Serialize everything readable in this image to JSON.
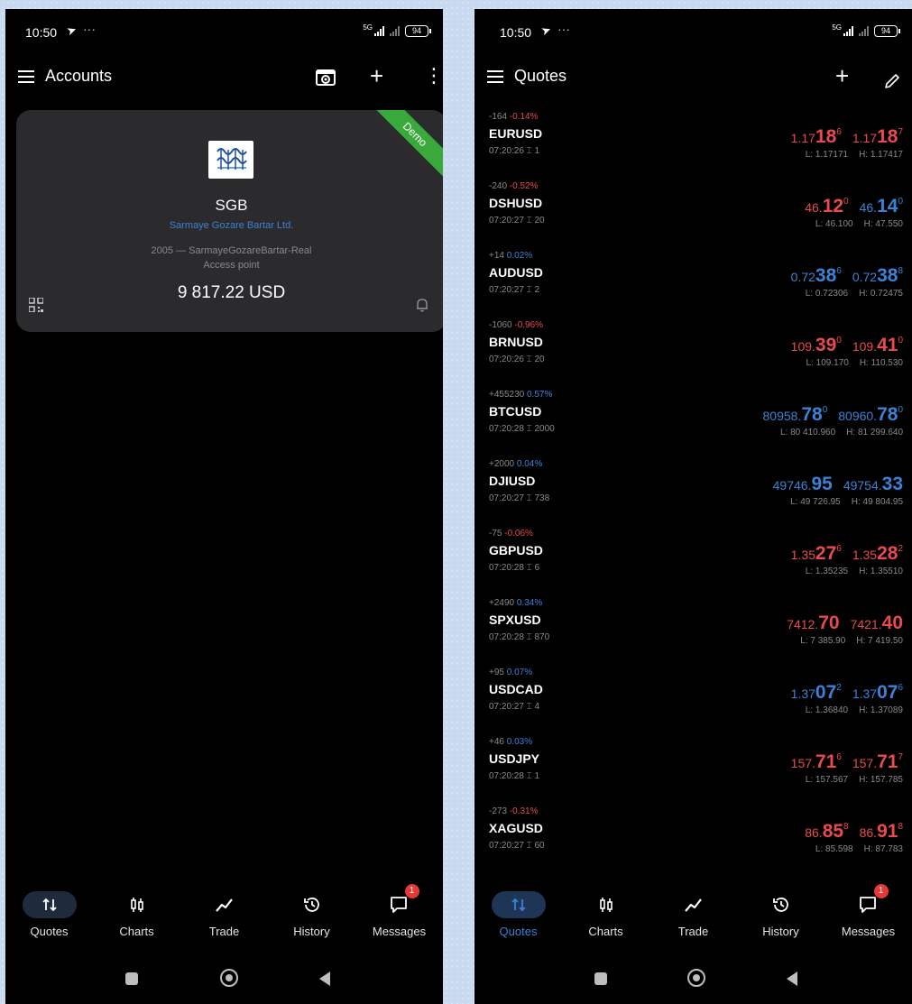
{
  "status_bar": {
    "time": "10:50",
    "dots": "···",
    "battery": "94",
    "net_label": "5G"
  },
  "accounts_screen": {
    "title": "Accounts",
    "card": {
      "ribbon": "Demo",
      "name": "SGB",
      "company": "Sarmaye Gozare Bartar Ltd.",
      "server": "2005 — SarmayeGozareBartar-Real",
      "access": "Access point",
      "balance": "9 817.22 USD"
    }
  },
  "quotes_screen": {
    "title": "Quotes",
    "quotes": [
      {
        "change": "-164",
        "pct": "-0.14%",
        "dir": "neg",
        "symbol": "EURUSD",
        "time": "07:20:26",
        "spread": "1",
        "bid": {
          "pre": "1.17",
          "big": "18",
          "sup": "6"
        },
        "ask": {
          "pre": "1.17",
          "big": "18",
          "sup": "7"
        },
        "low": "L: 1.17171",
        "high": "H: 1.17417",
        "color": "neg"
      },
      {
        "change": "-240",
        "pct": "-0.52%",
        "dir": "neg",
        "symbol": "DSHUSD",
        "time": "07:20:27",
        "spread": "20",
        "bid": {
          "pre": "46.",
          "big": "12",
          "sup": "0"
        },
        "ask": {
          "pre": "46.",
          "big": "14",
          "sup": "0"
        },
        "low": "L: 46.100",
        "high": "H: 47.550",
        "color": "mixed"
      },
      {
        "change": "+14",
        "pct": "0.02%",
        "dir": "pos",
        "symbol": "AUDUSD",
        "time": "07:20:27",
        "spread": "2",
        "bid": {
          "pre": "0.72",
          "big": "38",
          "sup": "6"
        },
        "ask": {
          "pre": "0.72",
          "big": "38",
          "sup": "8"
        },
        "low": "L: 0.72306",
        "high": "H: 0.72475",
        "color": "pos"
      },
      {
        "change": "-1060",
        "pct": "-0.96%",
        "dir": "neg",
        "symbol": "BRNUSD",
        "time": "07:20:26",
        "spread": "20",
        "bid": {
          "pre": "109.",
          "big": "39",
          "sup": "0"
        },
        "ask": {
          "pre": "109.",
          "big": "41",
          "sup": "0"
        },
        "low": "L: 109.170",
        "high": "H: 110.530",
        "color": "neg"
      },
      {
        "change": "+455230",
        "pct": "0.57%",
        "dir": "pos",
        "symbol": "BTCUSD",
        "time": "07:20:28",
        "spread": "2000",
        "bid": {
          "pre": "80958.",
          "big": "78",
          "sup": "0"
        },
        "ask": {
          "pre": "80960.",
          "big": "78",
          "sup": "0"
        },
        "low": "L: 80 410.960",
        "high": "H: 81 299.640",
        "color": "pos"
      },
      {
        "change": "+2000",
        "pct": "0.04%",
        "dir": "pos",
        "symbol": "DJIUSD",
        "time": "07:20:27",
        "spread": "738",
        "bid": {
          "pre": "49746.",
          "big": "95",
          "sup": ""
        },
        "ask": {
          "pre": "49754.",
          "big": "33",
          "sup": ""
        },
        "low": "L: 49 726.95",
        "high": "H: 49 804.95",
        "color": "pos"
      },
      {
        "change": "-75",
        "pct": "-0.06%",
        "dir": "neg",
        "symbol": "GBPUSD",
        "time": "07:20:28",
        "spread": "6",
        "bid": {
          "pre": "1.35",
          "big": "27",
          "sup": "6"
        },
        "ask": {
          "pre": "1.35",
          "big": "28",
          "sup": "2"
        },
        "low": "L: 1.35235",
        "high": "H: 1.35510",
        "color": "neg"
      },
      {
        "change": "+2490",
        "pct": "0.34%",
        "dir": "pos",
        "symbol": "SPXUSD",
        "time": "07:20:28",
        "spread": "870",
        "bid": {
          "pre": "7412.",
          "big": "70",
          "sup": ""
        },
        "ask": {
          "pre": "7421.",
          "big": "40",
          "sup": ""
        },
        "low": "L: 7 385.90",
        "high": "H: 7 419.50",
        "color": "neg"
      },
      {
        "change": "+95",
        "pct": "0.07%",
        "dir": "pos",
        "symbol": "USDCAD",
        "time": "07:20:27",
        "spread": "4",
        "bid": {
          "pre": "1.37",
          "big": "07",
          "sup": "2"
        },
        "ask": {
          "pre": "1.37",
          "big": "07",
          "sup": "6"
        },
        "low": "L: 1.36840",
        "high": "H: 1.37089",
        "color": "pos"
      },
      {
        "change": "+46",
        "pct": "0.03%",
        "dir": "pos",
        "symbol": "USDJPY",
        "time": "07:20:28",
        "spread": "1",
        "bid": {
          "pre": "157.",
          "big": "71",
          "sup": "6"
        },
        "ask": {
          "pre": "157.",
          "big": "71",
          "sup": "7"
        },
        "low": "L: 157.567",
        "high": "H: 157.785",
        "color": "neg"
      },
      {
        "change": "-273",
        "pct": "-0.31%",
        "dir": "neg",
        "symbol": "XAGUSD",
        "time": "07:20:27",
        "spread": "60",
        "bid": {
          "pre": "86.",
          "big": "85",
          "sup": "8"
        },
        "ask": {
          "pre": "86.",
          "big": "91",
          "sup": "8"
        },
        "low": "L: 85.598",
        "high": "H: 87.783",
        "color": "neg"
      }
    ]
  },
  "bottom_nav": {
    "items": [
      {
        "label": "Quotes",
        "icon": "quotes-icon"
      },
      {
        "label": "Charts",
        "icon": "charts-icon"
      },
      {
        "label": "Trade",
        "icon": "trade-icon"
      },
      {
        "label": "History",
        "icon": "history-icon"
      },
      {
        "label": "Messages",
        "icon": "messages-icon"
      }
    ],
    "messages_badge": "1"
  },
  "colors": {
    "negative": "#e84a4f",
    "positive": "#3b82d6",
    "ribbon": "#3aa93c",
    "card": "#2b2b2d"
  }
}
